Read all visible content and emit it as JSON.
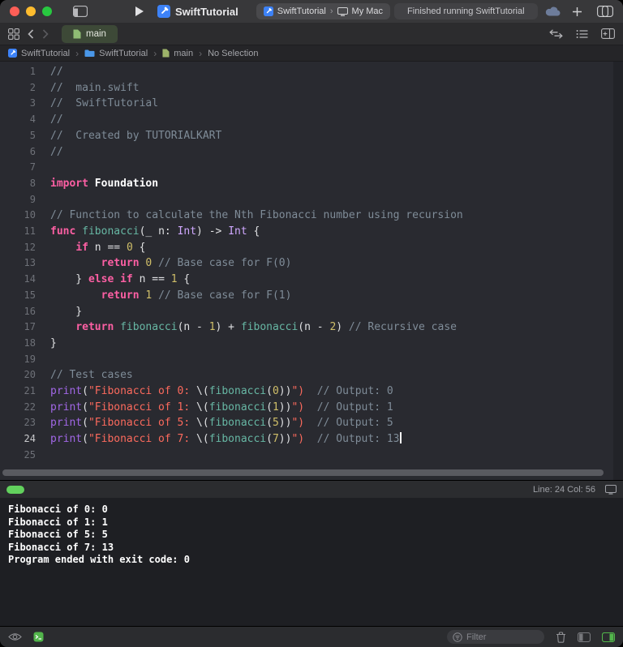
{
  "titlebar": {
    "title": "SwiftTutorial",
    "scheme_project": "SwiftTutorial",
    "scheme_destination": "My Mac",
    "status": "Finished running SwiftTutorial"
  },
  "tabbar": {
    "active_tab_label": "main"
  },
  "breadcrumb": {
    "items": [
      {
        "label": "SwiftTutorial"
      },
      {
        "label": "SwiftTutorial"
      },
      {
        "label": "main"
      },
      {
        "label": "No Selection"
      }
    ]
  },
  "editor": {
    "lines": [
      {
        "num": "1",
        "segments": [
          {
            "c": "com",
            "t": "//"
          }
        ]
      },
      {
        "num": "2",
        "segments": [
          {
            "c": "com",
            "t": "//  main.swift"
          }
        ]
      },
      {
        "num": "3",
        "segments": [
          {
            "c": "com",
            "t": "//  SwiftTutorial"
          }
        ]
      },
      {
        "num": "4",
        "segments": [
          {
            "c": "com",
            "t": "//"
          }
        ]
      },
      {
        "num": "5",
        "segments": [
          {
            "c": "com",
            "t": "//  Created by TUTORIALKART"
          }
        ]
      },
      {
        "num": "6",
        "segments": [
          {
            "c": "com",
            "t": "//"
          }
        ]
      },
      {
        "num": "7",
        "segments": []
      },
      {
        "num": "8",
        "segments": [
          {
            "c": "kw",
            "t": "import"
          },
          {
            "c": "plainb",
            "t": " Foundation"
          }
        ]
      },
      {
        "num": "9",
        "segments": []
      },
      {
        "num": "10",
        "segments": [
          {
            "c": "com",
            "t": "// Function to calculate the Nth Fibonacci number using recursion"
          }
        ]
      },
      {
        "num": "11",
        "segments": [
          {
            "c": "kw",
            "t": "func"
          },
          {
            "c": "plain",
            "t": " "
          },
          {
            "c": "fn",
            "t": "fibonacci"
          },
          {
            "c": "plain",
            "t": "(_ n: "
          },
          {
            "c": "type",
            "t": "Int"
          },
          {
            "c": "plain",
            "t": ") -> "
          },
          {
            "c": "type",
            "t": "Int"
          },
          {
            "c": "plain",
            "t": " {"
          }
        ]
      },
      {
        "num": "12",
        "segments": [
          {
            "c": "plain",
            "t": "    "
          },
          {
            "c": "kw",
            "t": "if"
          },
          {
            "c": "plain",
            "t": " n == "
          },
          {
            "c": "num",
            "t": "0"
          },
          {
            "c": "plain",
            "t": " {"
          }
        ]
      },
      {
        "num": "13",
        "segments": [
          {
            "c": "plain",
            "t": "        "
          },
          {
            "c": "kw",
            "t": "return"
          },
          {
            "c": "plain",
            "t": " "
          },
          {
            "c": "num",
            "t": "0"
          },
          {
            "c": "com",
            "t": " // Base case for F(0)"
          }
        ]
      },
      {
        "num": "14",
        "segments": [
          {
            "c": "plain",
            "t": "    } "
          },
          {
            "c": "kw",
            "t": "else"
          },
          {
            "c": "plain",
            "t": " "
          },
          {
            "c": "kw",
            "t": "if"
          },
          {
            "c": "plain",
            "t": " n == "
          },
          {
            "c": "num",
            "t": "1"
          },
          {
            "c": "plain",
            "t": " {"
          }
        ]
      },
      {
        "num": "15",
        "segments": [
          {
            "c": "plain",
            "t": "        "
          },
          {
            "c": "kw",
            "t": "return"
          },
          {
            "c": "plain",
            "t": " "
          },
          {
            "c": "num",
            "t": "1"
          },
          {
            "c": "com",
            "t": " // Base case for F(1)"
          }
        ]
      },
      {
        "num": "16",
        "segments": [
          {
            "c": "plain",
            "t": "    }"
          }
        ]
      },
      {
        "num": "17",
        "segments": [
          {
            "c": "plain",
            "t": "    "
          },
          {
            "c": "kw",
            "t": "return"
          },
          {
            "c": "plain",
            "t": " "
          },
          {
            "c": "fn",
            "t": "fibonacci"
          },
          {
            "c": "plain",
            "t": "(n - "
          },
          {
            "c": "num",
            "t": "1"
          },
          {
            "c": "plain",
            "t": ") + "
          },
          {
            "c": "fn",
            "t": "fibonacci"
          },
          {
            "c": "plain",
            "t": "(n - "
          },
          {
            "c": "num",
            "t": "2"
          },
          {
            "c": "plain",
            "t": ") "
          },
          {
            "c": "com",
            "t": "// Recursive case"
          }
        ]
      },
      {
        "num": "18",
        "segments": [
          {
            "c": "plain",
            "t": "}"
          }
        ]
      },
      {
        "num": "19",
        "segments": []
      },
      {
        "num": "20",
        "segments": [
          {
            "c": "com",
            "t": "// Test cases"
          }
        ]
      },
      {
        "num": "21",
        "segments": [
          {
            "c": "stdfn",
            "t": "print"
          },
          {
            "c": "plain",
            "t": "("
          },
          {
            "c": "str",
            "t": "\"Fibonacci of 0: "
          },
          {
            "c": "plain",
            "t": "\\("
          },
          {
            "c": "fn",
            "t": "fibonacci"
          },
          {
            "c": "plain",
            "t": "("
          },
          {
            "c": "num",
            "t": "0"
          },
          {
            "c": "plain",
            "t": "))"
          },
          {
            "c": "str",
            "t": "\")"
          },
          {
            "c": "com",
            "t": "  // Output: 0"
          }
        ]
      },
      {
        "num": "22",
        "segments": [
          {
            "c": "stdfn",
            "t": "print"
          },
          {
            "c": "plain",
            "t": "("
          },
          {
            "c": "str",
            "t": "\"Fibonacci of 1: "
          },
          {
            "c": "plain",
            "t": "\\("
          },
          {
            "c": "fn",
            "t": "fibonacci"
          },
          {
            "c": "plain",
            "t": "("
          },
          {
            "c": "num",
            "t": "1"
          },
          {
            "c": "plain",
            "t": "))"
          },
          {
            "c": "str",
            "t": "\")"
          },
          {
            "c": "com",
            "t": "  // Output: 1"
          }
        ]
      },
      {
        "num": "23",
        "segments": [
          {
            "c": "stdfn",
            "t": "print"
          },
          {
            "c": "plain",
            "t": "("
          },
          {
            "c": "str",
            "t": "\"Fibonacci of 5: "
          },
          {
            "c": "plain",
            "t": "\\("
          },
          {
            "c": "fn",
            "t": "fibonacci"
          },
          {
            "c": "plain",
            "t": "("
          },
          {
            "c": "num",
            "t": "5"
          },
          {
            "c": "plain",
            "t": "))"
          },
          {
            "c": "str",
            "t": "\")"
          },
          {
            "c": "com",
            "t": "  // Output: 5"
          }
        ]
      },
      {
        "num": "24",
        "current": true,
        "caret": true,
        "segments": [
          {
            "c": "stdfn",
            "t": "print"
          },
          {
            "c": "plain",
            "t": "("
          },
          {
            "c": "str",
            "t": "\"Fibonacci of 7: "
          },
          {
            "c": "plain",
            "t": "\\("
          },
          {
            "c": "fn",
            "t": "fibonacci"
          },
          {
            "c": "plain",
            "t": "("
          },
          {
            "c": "num",
            "t": "7"
          },
          {
            "c": "plain",
            "t": "))"
          },
          {
            "c": "str",
            "t": "\")"
          },
          {
            "c": "com",
            "t": "  // Output: 13"
          }
        ]
      },
      {
        "num": "25",
        "segments": []
      }
    ]
  },
  "debugbar": {
    "line_col": "Line: 24 Col: 56"
  },
  "console": {
    "lines": [
      "Fibonacci of 0: 0",
      "Fibonacci of 1: 1",
      "Fibonacci of 5: 5",
      "Fibonacci of 7: 13",
      "Program ended with exit code: 0"
    ]
  },
  "bottombar": {
    "filter_placeholder": "Filter"
  },
  "icons": {
    "traffic": [
      "close-icon",
      "minimize-icon",
      "zoom-icon"
    ],
    "titlebar": [
      "navigator-toggle-icon",
      "play-icon",
      "xcode-project-icon",
      "monitor-icon",
      "cloud-icon",
      "plus-icon",
      "window-tabs-icon"
    ],
    "tabbar": [
      "tab-overview-icon",
      "chevron-left-icon",
      "chevron-right-icon",
      "swift-file-icon",
      "code-review-icon",
      "editor-options-icon",
      "add-editor-icon"
    ],
    "breadcrumb": [
      "xcode-project-icon",
      "folder-icon",
      "swift-file-icon"
    ],
    "bottombar": [
      "eye-icon",
      "debug-console-icon",
      "filter-icon",
      "trash-icon",
      "pane-toggle-icon",
      "console-pane-icon"
    ]
  },
  "colors": {
    "traffic_red": "#ff5f57",
    "traffic_yellow": "#febc2e",
    "traffic_green": "#28c840",
    "run_indicator_green": "#62d15d",
    "active_tab_tint": "#3d4937",
    "syntax": {
      "keyword": "#fc5fa3",
      "string": "#fc6a5d",
      "number": "#d0bf69",
      "comment": "#7f8c98",
      "project_function": "#67b7a4",
      "std_function": "#a167e6",
      "type": "#d0a8ff",
      "plain": "#dfe0e2"
    }
  }
}
